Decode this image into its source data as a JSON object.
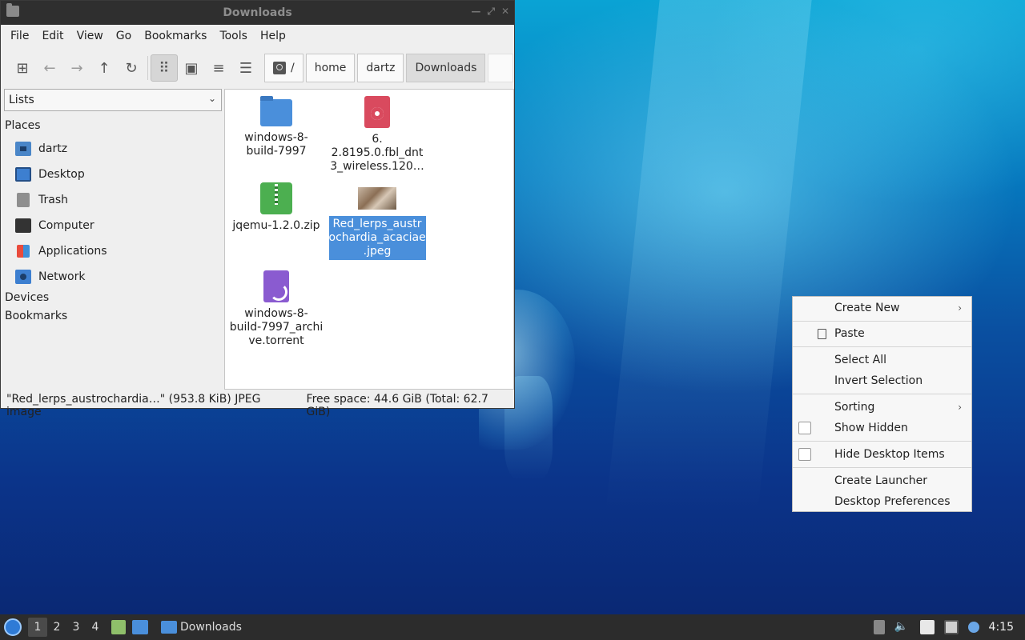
{
  "window": {
    "title": "Downloads",
    "menu": [
      "File",
      "Edit",
      "View",
      "Go",
      "Bookmarks",
      "Tools",
      "Help"
    ],
    "path": {
      "root": "/",
      "crumbs": [
        "home",
        "dartz",
        "Downloads"
      ]
    },
    "sidebar": {
      "selector": "Lists",
      "places_header": "Places",
      "places": [
        "dartz",
        "Desktop",
        "Trash",
        "Computer",
        "Applications",
        "Network"
      ],
      "devices_header": "Devices",
      "bookmarks_header": "Bookmarks"
    },
    "files": [
      {
        "name": "windows-8-\nbuild-7997",
        "line1": "windows-8-",
        "line2": "build-7997",
        "icon": "folder-icon"
      },
      {
        "line1": "6.",
        "line2": "2.8195.0.fbl_dnt",
        "line3": "3_wireless.120…",
        "icon": "disc-image-icon"
      },
      {
        "line1": "jqemu-1.2.0.zip",
        "icon": "zip-archive-icon"
      },
      {
        "line1": "Red_lerps_austr",
        "line2": "ochardia_acaciae",
        "line3": ".jpeg",
        "icon": "image-thumbnail-icon",
        "selected": true
      },
      {
        "line1": "windows-8-",
        "line2": "build-7997_archi",
        "line3": "ve.torrent",
        "icon": "torrent-icon"
      }
    ],
    "status": {
      "selection": "\"Red_lerps_austrochardia…\" (953.8 KiB) JPEG image",
      "free_space": "Free space: 44.6 GiB (Total: 62.7 GiB)"
    }
  },
  "context_menu": {
    "create_new": "Create New",
    "paste": "Paste",
    "select_all": "Select All",
    "invert_selection": "Invert Selection",
    "sorting": "Sorting",
    "show_hidden": "Show Hidden",
    "hide_desktop_items": "Hide Desktop Items",
    "create_launcher": "Create Launcher",
    "desktop_preferences": "Desktop Preferences"
  },
  "panel": {
    "workspaces": [
      "1",
      "2",
      "3",
      "4"
    ],
    "active_workspace": "1",
    "task": "Downloads",
    "clock": "4:15"
  },
  "colors": {
    "selection": "#4a8fdb",
    "panel_bg": "#2c2c2c",
    "titlebar_bg": "#2f2f2f"
  }
}
